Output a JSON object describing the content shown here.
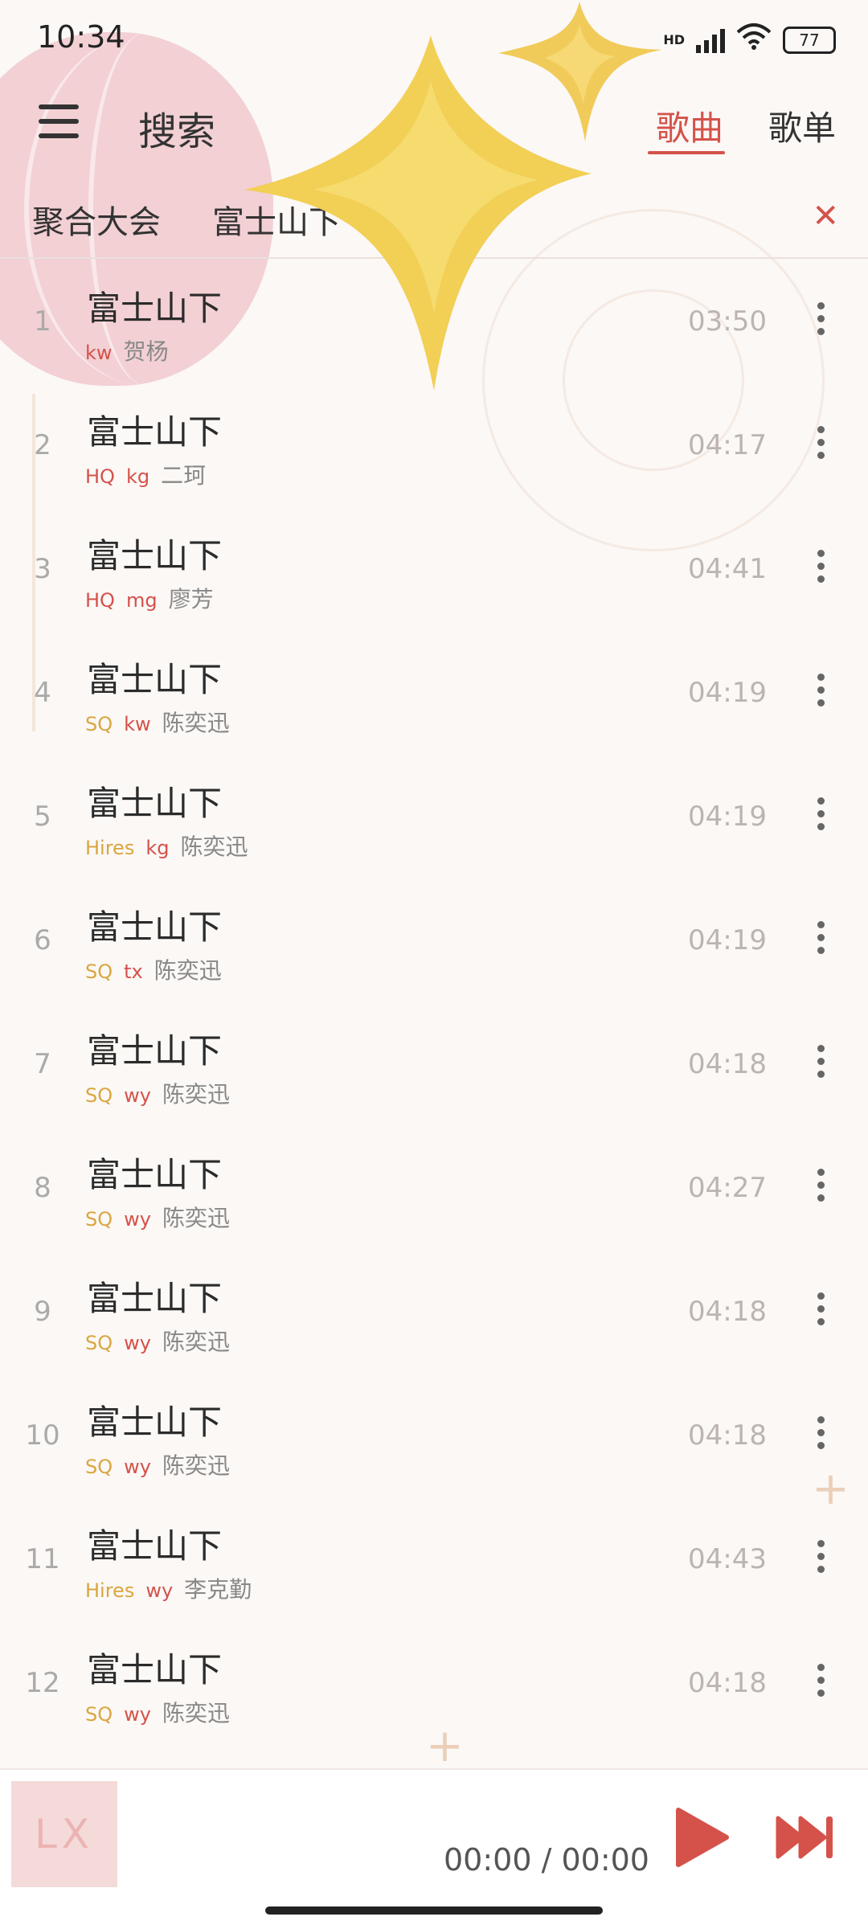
{
  "status_bar": {
    "time": "10:34",
    "network": "HD",
    "battery": "77"
  },
  "header": {
    "title": "搜索",
    "tabs": [
      {
        "label": "歌曲"
      },
      {
        "label": "歌单"
      }
    ]
  },
  "search": {
    "source": "聚合大会",
    "query": "富士山下"
  },
  "songs": [
    {
      "index": "1",
      "title": "富士山下",
      "quality": "",
      "source": "kw",
      "artist": "贺杨",
      "duration": "03:50"
    },
    {
      "index": "2",
      "title": "富士山下",
      "quality": "HQ",
      "source": "kg",
      "artist": "二珂",
      "duration": "04:17"
    },
    {
      "index": "3",
      "title": "富士山下",
      "quality": "HQ",
      "source": "mg",
      "artist": "廖芳",
      "duration": "04:41"
    },
    {
      "index": "4",
      "title": "富士山下",
      "quality": "SQ",
      "source": "kw",
      "artist": "陈奕迅",
      "duration": "04:19"
    },
    {
      "index": "5",
      "title": "富士山下",
      "quality": "Hires",
      "source": "kg",
      "artist": "陈奕迅",
      "duration": "04:19"
    },
    {
      "index": "6",
      "title": "富士山下",
      "quality": "SQ",
      "source": "tx",
      "artist": "陈奕迅",
      "duration": "04:19"
    },
    {
      "index": "7",
      "title": "富士山下",
      "quality": "SQ",
      "source": "wy",
      "artist": "陈奕迅",
      "duration": "04:18"
    },
    {
      "index": "8",
      "title": "富士山下",
      "quality": "SQ",
      "source": "wy",
      "artist": "陈奕迅",
      "duration": "04:27"
    },
    {
      "index": "9",
      "title": "富士山下",
      "quality": "SQ",
      "source": "wy",
      "artist": "陈奕迅",
      "duration": "04:18"
    },
    {
      "index": "10",
      "title": "富士山下",
      "quality": "SQ",
      "source": "wy",
      "artist": "陈奕迅",
      "duration": "04:18"
    },
    {
      "index": "11",
      "title": "富士山下",
      "quality": "Hires",
      "source": "wy",
      "artist": "李克勤",
      "duration": "04:43"
    },
    {
      "index": "12",
      "title": "富士山下",
      "quality": "SQ",
      "source": "wy",
      "artist": "陈奕迅",
      "duration": "04:18"
    }
  ],
  "player": {
    "cover_text": "LX",
    "time": "00:00 / 00:00"
  },
  "icons": {
    "menu": "menu-icon",
    "clear": "close-icon",
    "more": "more-vertical-icon",
    "play": "play-icon",
    "next": "skip-next-icon"
  },
  "colors": {
    "accent": "#d4524a",
    "quality_gold": "#d9a63e",
    "star": "#f2cf55"
  }
}
